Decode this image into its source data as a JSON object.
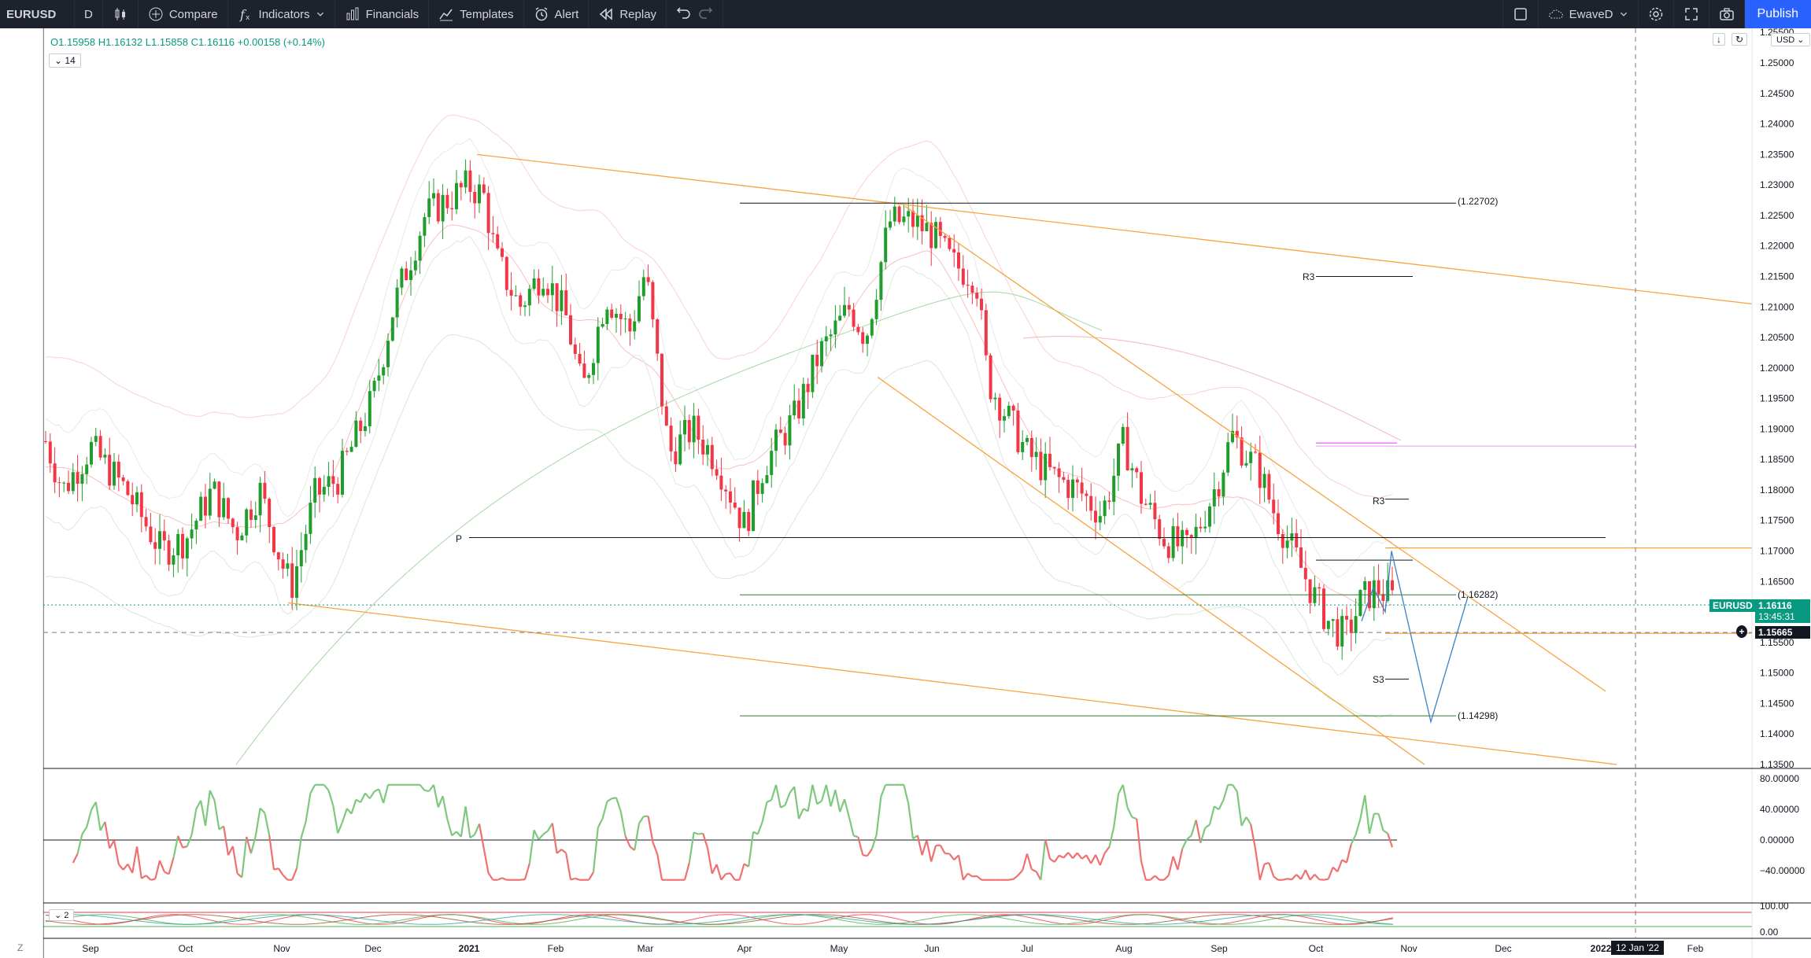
{
  "toolbar": {
    "symbol": "EURUSD",
    "interval": "D",
    "compare": "Compare",
    "indicators": "Indicators",
    "financials": "Financials",
    "templates": "Templates",
    "alert": "Alert",
    "replay": "Replay",
    "layout_name": "EwaveD",
    "publish": "Publish"
  },
  "legend": {
    "open": "O1.15958",
    "high": "H1.16132",
    "low": "L1.15858",
    "close": "C1.16116",
    "change": "+0.00158 (+0.14%)",
    "indicator_count": "14",
    "subpane_count": "2"
  },
  "price_axis": {
    "currency": "USD",
    "ticks": [
      "1.25500",
      "1.25000",
      "1.24500",
      "1.24000",
      "1.23500",
      "1.23000",
      "1.22500",
      "1.22000",
      "1.21500",
      "1.21000",
      "1.20500",
      "1.20000",
      "1.19500",
      "1.19000",
      "1.18500",
      "1.18000",
      "1.17500",
      "1.17000",
      "1.16500",
      "1.16000",
      "1.15500",
      "1.15000",
      "1.14500",
      "1.14000",
      "1.13500"
    ],
    "last_symbol": "EURUSD",
    "last_price": "1.16116",
    "countdown": "13:45:31",
    "crosshair_price": "1.15665"
  },
  "osc_axis": {
    "ticks": [
      "80.00000",
      "40.00000",
      "0.00000",
      "−40.00000"
    ]
  },
  "osc2_axis": {
    "ticks": [
      "100.00",
      "0.00"
    ]
  },
  "time_axis": {
    "ticks": [
      "Sep",
      "Oct",
      "Nov",
      "Dec",
      "2021",
      "Feb",
      "Mar",
      "Apr",
      "May",
      "Jun",
      "Jul",
      "Aug",
      "Sep",
      "Oct",
      "Nov",
      "Dec",
      "2022",
      "Feb"
    ],
    "crosshair_date": "12 Jan '22"
  },
  "annotations": {
    "level_upper": "(1.22702)",
    "level_mid": "(1.16282)",
    "level_lower": "(1.14298)",
    "pivot_p": "P",
    "pivot_r3_a": "R3",
    "pivot_r3_b": "R3",
    "pivot_s3": "S3"
  },
  "colors": {
    "up": "#089981",
    "candle_up": "#1f9e2d",
    "candle_down": "#f23645",
    "trend": "#f7a440",
    "projection": "#3d7fc8",
    "osc_up": "#7ec87e",
    "osc_down": "#f07070"
  }
}
